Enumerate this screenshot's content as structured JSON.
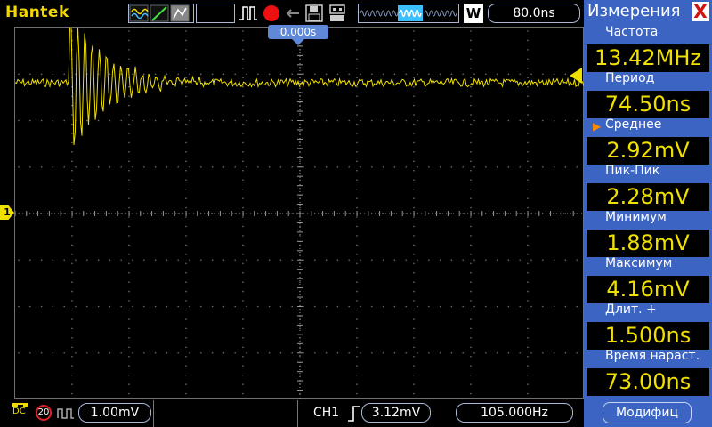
{
  "header": {
    "brand": "Hantek",
    "timebase": "80.0ns",
    "w_label": "W"
  },
  "screen": {
    "trigger_time": "0.000s",
    "channel_marker": "1"
  },
  "footer": {
    "coupling": "DC",
    "bw_limit": "20",
    "ch_scale": "1.00mV",
    "trigger_source": "CH1",
    "trigger_level": "3.12mV",
    "frequency": "105.000Hz"
  },
  "panel": {
    "title": "Измерения",
    "close": "X",
    "modify": "Модифиц",
    "measurements": [
      {
        "label": "Частота",
        "value": "13.42MHz"
      },
      {
        "label": "Период",
        "value": "74.50ns"
      },
      {
        "label": "Среднее",
        "value": "2.92mV",
        "selected": true
      },
      {
        "label": "Пик-Пик",
        "value": "2.28mV"
      },
      {
        "label": "Минимум",
        "value": "1.88mV"
      },
      {
        "label": "Максимум",
        "value": "4.16mV"
      },
      {
        "label": "Длит.  +",
        "value": "1.500ns"
      },
      {
        "label": "Время  нараст.",
        "value": "73.00ns"
      }
    ]
  },
  "colors": {
    "trace": "#f0e000",
    "panel_bg": "#3c64c2",
    "brand": "#f0d800"
  }
}
